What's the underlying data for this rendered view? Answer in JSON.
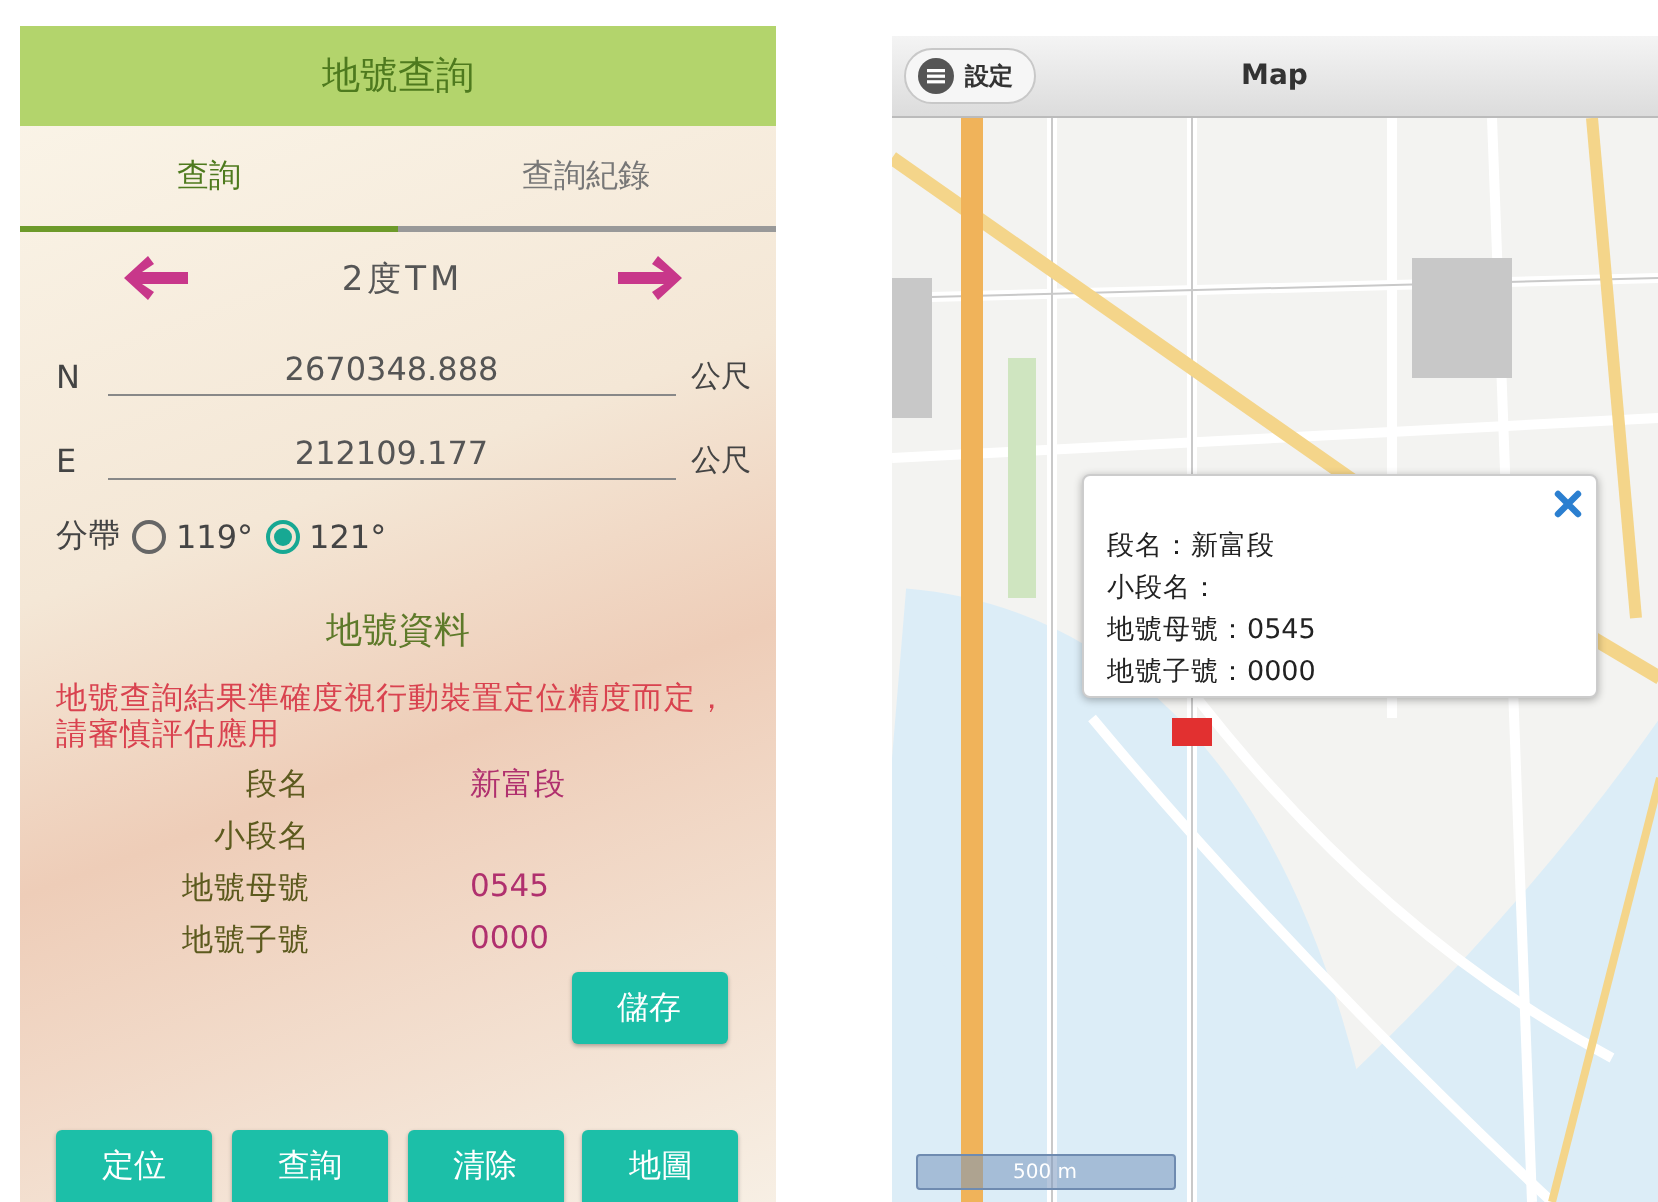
{
  "query_screen": {
    "title": "地號查詢",
    "tabs": [
      {
        "label": "查詢",
        "selected": true
      },
      {
        "label": "查詢紀錄",
        "selected": false
      }
    ],
    "projection": "2度TM",
    "coordinates": [
      {
        "axis": "N",
        "value": "2670348.888",
        "unit": "公尺"
      },
      {
        "axis": "E",
        "value": "212109.177",
        "unit": "公尺"
      }
    ],
    "zone": {
      "label": "分帶",
      "options": [
        {
          "label": "119°",
          "selected": false
        },
        {
          "label": "121°",
          "selected": true
        }
      ]
    },
    "section_title": "地號資料",
    "warning": "地號查詢結果準確度視行動裝置定位精度而定，請審慎評估應用",
    "fields": [
      {
        "label": "段名",
        "value": "新富段"
      },
      {
        "label": "小段名"
      },
      {
        "label": "地號母號",
        "value": "0545"
      },
      {
        "label": "地號子號",
        "value": "0000"
      }
    ],
    "save_button": "儲存",
    "buttons": [
      "定位",
      "查詢",
      "清除",
      "地圖"
    ]
  },
  "map_screen": {
    "settings_button": "設定",
    "title": "Map",
    "popup": {
      "lines": [
        "段名：新富段",
        "小段名：",
        "地號母號：0545",
        "地號子號：0000"
      ]
    },
    "scale": "500 m"
  }
}
